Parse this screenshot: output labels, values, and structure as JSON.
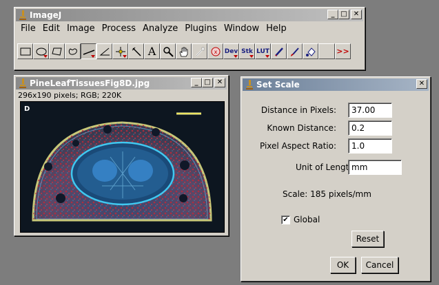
{
  "imagej": {
    "title": "ImageJ",
    "menu": [
      "File",
      "Edit",
      "Image",
      "Process",
      "Analyze",
      "Plugins",
      "Window",
      "Help"
    ],
    "tools": [
      "rectangle",
      "oval",
      "polygon",
      "freehand",
      "line",
      "angle",
      "point",
      "wand",
      "text",
      "magnifier",
      "hand",
      "color-picker",
      "record",
      "Dev",
      "Stk",
      "LUT",
      "pencil",
      "brush",
      "flood-fill",
      "blank",
      "more"
    ],
    "tool_labels": {
      "dev": "Dev",
      "stk": "Stk",
      "lut": "LUT",
      "more": ">>"
    }
  },
  "image_window": {
    "title": "PineLeafTissuesFig8D.jpg",
    "info": "296x190 pixels; RGB; 220K",
    "panel_letter": "D"
  },
  "set_scale": {
    "title": "Set Scale",
    "distance_label": "Distance in Pixels:",
    "distance_value": "37.00",
    "known_label": "Known Distance:",
    "known_value": "0.2",
    "aspect_label": "Pixel Aspect Ratio:",
    "aspect_value": "1.0",
    "unit_label": "Unit of Length:",
    "unit_value": "mm",
    "scale_text": "Scale: 185 pixels/mm",
    "global_label": "Global",
    "global_checked": "✔",
    "reset_label": "Reset",
    "ok_label": "OK",
    "cancel_label": "Cancel"
  },
  "window_buttons": {
    "minimize": "_",
    "maximize": "□",
    "close": "✕"
  }
}
